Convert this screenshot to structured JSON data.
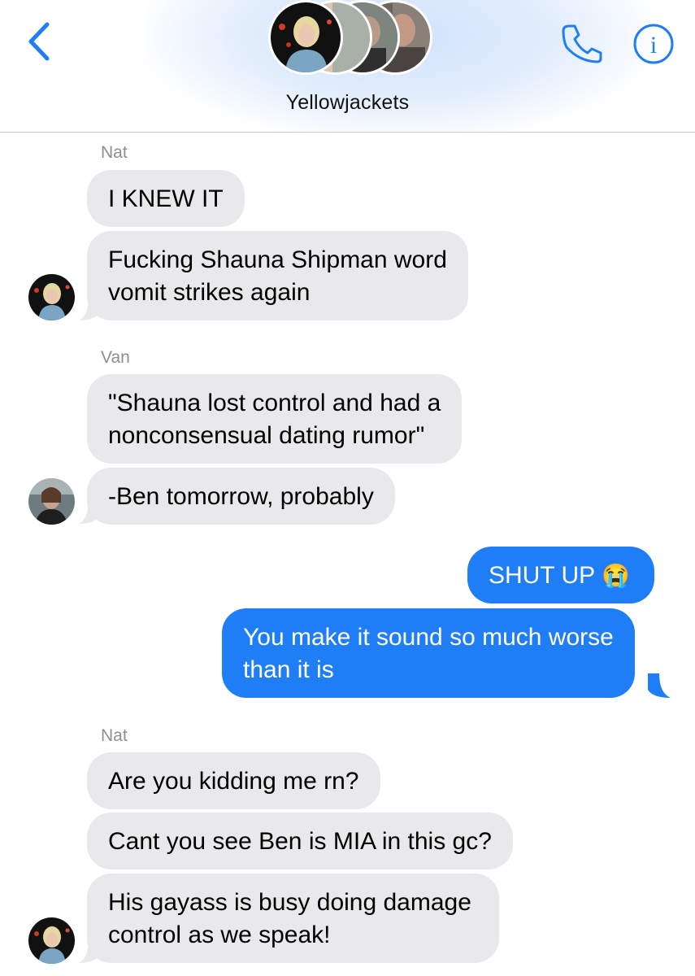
{
  "header": {
    "title": "Yellowjackets",
    "back_icon": "chevron-left-icon",
    "call_icon": "phone-icon",
    "info_icon": "info-icon",
    "accent": "#1f7ef6"
  },
  "messages": [
    {
      "sender": "Nat"
    },
    {
      "text": "I KNEW IT"
    },
    {
      "text_line1": "Fucking Shauna Shipman word",
      "text_line2": "vomit strikes again"
    },
    {
      "sender": "Van"
    },
    {
      "text_line1": "\"Shauna lost control and had a",
      "text_line2": "nonconsensual dating rumor\""
    },
    {
      "text": "-Ben tomorrow, probably"
    },
    {
      "text": "SHUT UP",
      "emoji": "😭"
    },
    {
      "text_line1": "You make it sound so much worse",
      "text_line2": "than it is"
    },
    {
      "sender": "Nat"
    },
    {
      "text": "Are you kidding me rn?"
    },
    {
      "text": "Cant you see Ben is MIA in this gc?"
    },
    {
      "text_line1": "His gayass is busy doing damage",
      "text_line2": "control as we speak!"
    }
  ],
  "colors": {
    "received_bubble": "#e9e9eb",
    "sent_bubble": "#1f7ef6",
    "sender_label": "#8e8e93"
  }
}
